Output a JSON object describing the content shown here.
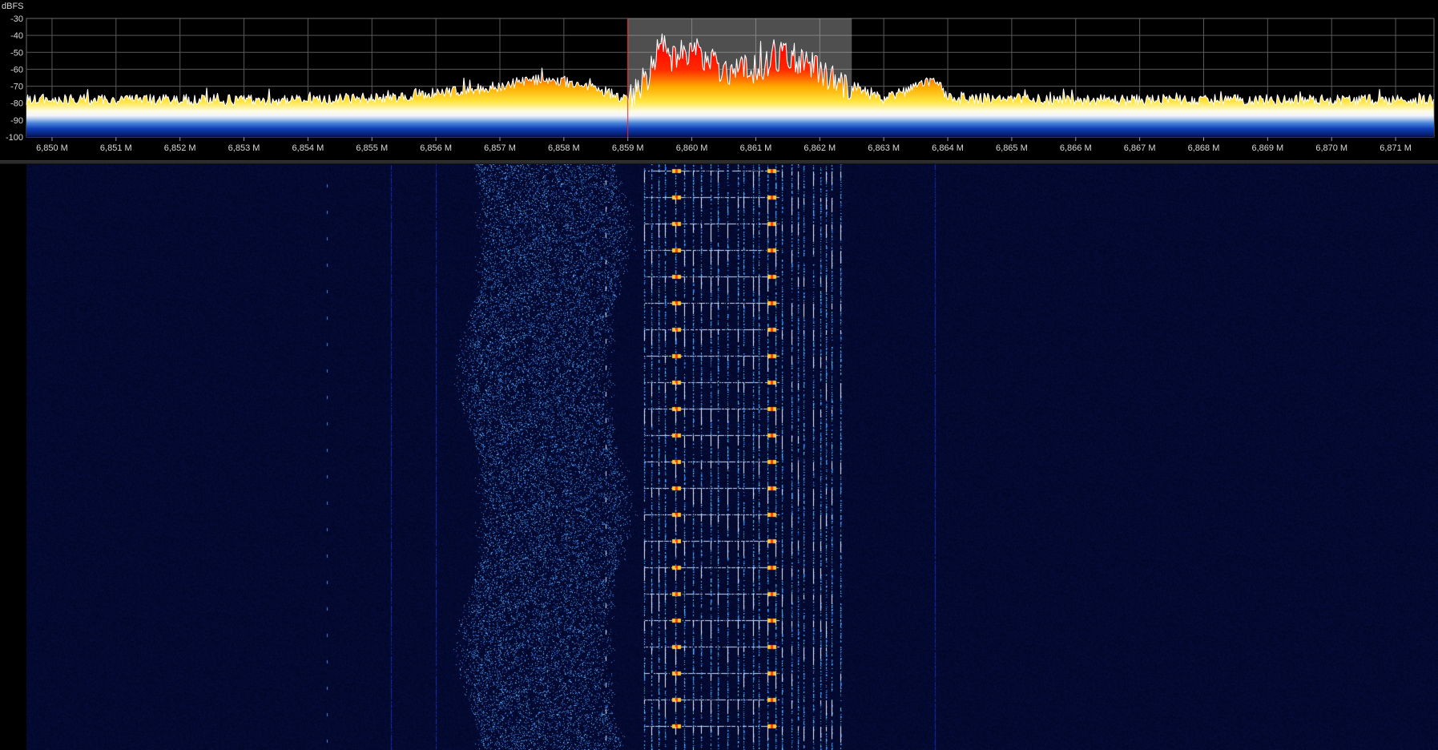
{
  "spectrum": {
    "unit_label": "dBFS",
    "y_ticks": [
      "-30",
      "-40",
      "-50",
      "-60",
      "-70",
      "-80",
      "-90",
      "-100"
    ],
    "y_values": [
      -30,
      -40,
      -50,
      -60,
      -70,
      -80,
      -90,
      -100
    ],
    "x_ticks": [
      "6,850 M",
      "6,851 M",
      "6,852 M",
      "6,853 M",
      "6,854 M",
      "6,855 M",
      "6,856 M",
      "6,857 M",
      "6,858 M",
      "6,859 M",
      "6,860 M",
      "6,861 M",
      "6,862 M",
      "6,863 M",
      "6,864 M",
      "6,865 M",
      "6,866 M",
      "6,867 M",
      "6,868 M",
      "6,869 M",
      "6,870 M",
      "6,871 M"
    ],
    "x_values_mhz": [
      6.85,
      6.851,
      6.852,
      6.853,
      6.854,
      6.855,
      6.856,
      6.857,
      6.858,
      6.859,
      6.86,
      6.861,
      6.862,
      6.863,
      6.864,
      6.865,
      6.866,
      6.867,
      6.868,
      6.869,
      6.87,
      6.871
    ],
    "x_range_mhz": [
      6.8496,
      6.8716
    ],
    "y_range_db": [
      -100,
      -30
    ],
    "selected_band_mhz": [
      6.859,
      6.8625
    ],
    "tuned_frequency_mhz": 6.859,
    "noise_floor_db": -78,
    "colors": {
      "background": "#000000",
      "grid": "#5a5a5a",
      "trace": "#ffffff",
      "selection": "#9a9a9a",
      "tuned_line": "#ff2020",
      "waterfall_floor": "#04093a"
    }
  },
  "chart_data": {
    "type": "area",
    "title": "",
    "xlabel": "",
    "ylabel": "dBFS",
    "xlim": [
      6.8496,
      6.8716
    ],
    "ylim": [
      -100,
      -30
    ],
    "grid": true,
    "series": [
      {
        "values_note_free": true,
        "x": [
          6.85,
          6.852,
          6.854,
          6.855,
          6.8555,
          6.856,
          6.857,
          6.8575,
          6.858,
          6.8585,
          6.859,
          6.8593,
          6.8595,
          6.8597,
          6.86,
          6.8605,
          6.861,
          6.8614,
          6.8618,
          6.862,
          6.8625,
          6.863,
          6.8638,
          6.864,
          6.866,
          6.868,
          6.87,
          6.8715
        ],
        "y": [
          -78,
          -78,
          -78,
          -77,
          -76,
          -74,
          -70,
          -66,
          -67,
          -71,
          -78,
          -65,
          -45,
          -55,
          -48,
          -60,
          -60,
          -52,
          -55,
          -62,
          -70,
          -78,
          -66,
          -77,
          -78,
          -78,
          -78,
          -78
        ]
      }
    ]
  }
}
